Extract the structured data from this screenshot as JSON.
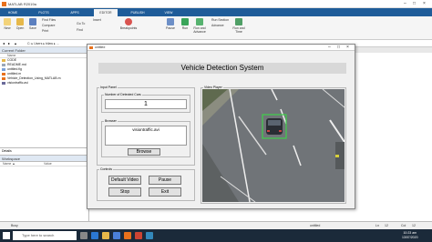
{
  "window": {
    "title": "MATLAB R2019a"
  },
  "ribbon_tabs": [
    "HOME",
    "PLOTS",
    "APPS",
    "EDITOR",
    "PUBLISH",
    "VIEW"
  ],
  "search": {
    "placeholder": "Search Documentation"
  },
  "user": "Bilawal",
  "ribbon": {
    "new_label": "New",
    "open_label": "Open",
    "save_label": "Save",
    "find_files_label": "Find Files",
    "compare_label": "Compare",
    "print_label": "Print",
    "goto_label": "Go To",
    "find_label": "Find",
    "insert_label": "Insert",
    "breakpoints_label": "Breakpoints",
    "pause_label": "Pause",
    "run_label": "Run",
    "run_advance_label": "Run and Advance",
    "run_section_label": "Run Section",
    "advance_label": "Advance",
    "run_time_label": "Run and Time"
  },
  "address": {
    "path": "C: ▸ Users ▸ bilaw ▸ ..."
  },
  "current_folder": {
    "title": "Current Folder",
    "name_header": "Name",
    "files": [
      "CODE",
      "README.md",
      "untitled.fig",
      "untitled.m",
      "Vehicle_Detection_Using_MATLAB.m",
      "visiontraffic.avi"
    ]
  },
  "details": {
    "title": "Details"
  },
  "workspace": {
    "title": "Workspace",
    "name_header": "Name ▲",
    "value_header": "Value"
  },
  "editor": {
    "file_tab": "untitled"
  },
  "figure": {
    "title": "untitled",
    "banner": "Vehicle Detection System",
    "input_panel": {
      "legend": "Input Panel",
      "cars_label": "Number of Detected Cars",
      "cars_value": "1",
      "browser_legend": "Browser",
      "file_value": "visiontraffic.avi",
      "browse_label": "Browse"
    },
    "controls": {
      "legend": "Controls",
      "default_video": "Default Video",
      "pause": "Pause",
      "stop": "Stop",
      "exit": "Exit"
    },
    "video_player": {
      "legend": "Video Player"
    }
  },
  "status": {
    "left": "Busy",
    "file": "untitled",
    "ln_label": "Ln",
    "ln_value": "12",
    "col_label": "Col",
    "col_value": "12"
  },
  "taskbar": {
    "search_placeholder": "Type here to search",
    "time": "10:23 am",
    "date": "13/07/2020"
  }
}
